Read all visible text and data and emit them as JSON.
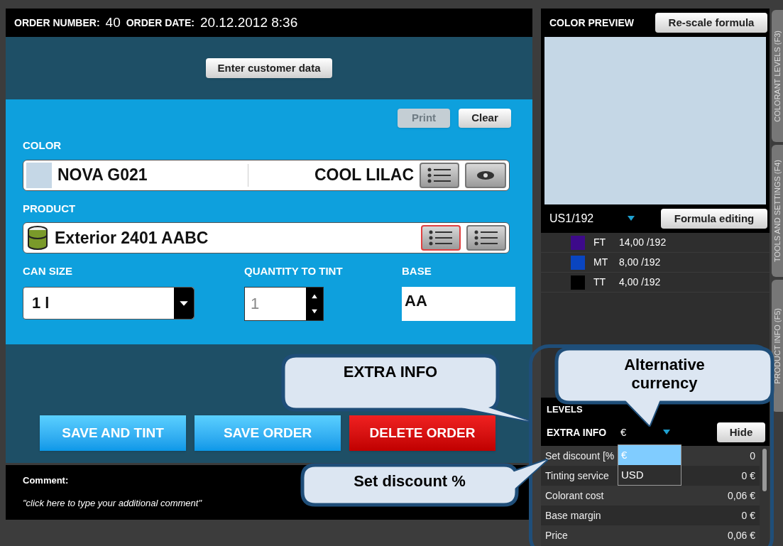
{
  "header": {
    "order_number_label": "ORDER NUMBER:",
    "order_number": "40",
    "order_date_label": "ORDER DATE:",
    "order_date": "20.12.2012 8:36"
  },
  "customer_button": "Enter customer data",
  "actions": [
    {
      "label": "Print",
      "disabled": true
    },
    {
      "label": "Clear",
      "disabled": false
    }
  ],
  "color": {
    "label": "COLOR",
    "code": "NOVA G021",
    "name": "COOL LILAC"
  },
  "product": {
    "label": "PRODUCT",
    "name": "Exterior 2401 AABC"
  },
  "can_size": {
    "label": "CAN SIZE",
    "value": "1 l"
  },
  "quantity": {
    "label": "QUANTITY TO TINT",
    "value": "1"
  },
  "base": {
    "label": "BASE",
    "value": "AA"
  },
  "buttons": [
    {
      "label": "SAVE AND TINT",
      "kind": "primary"
    },
    {
      "label": "SAVE ORDER",
      "kind": "primary"
    },
    {
      "label": "DELETE ORDER",
      "kind": "danger"
    }
  ],
  "comment": {
    "label": "Comment:",
    "placeholder": "\"click here to type your additional comment\""
  },
  "preview": {
    "title": "COLOR PREVIEW",
    "rescale_button": "Re-scale formula",
    "color": "#c5d7e6",
    "unit": "US1/192",
    "edit_button": "Formula editing"
  },
  "formula": [
    {
      "code": "FT",
      "amount": "14,00 /192",
      "color": "#3d0a8a"
    },
    {
      "code": "MT",
      "amount": "8,00 /192",
      "color": "#0a45c0"
    },
    {
      "code": "TT",
      "amount": "4,00 /192",
      "color": "#000000"
    }
  ],
  "levels_label": "LEVELS",
  "extra_info": {
    "title": "EXTRA INFO",
    "currency": "€",
    "hide_button": "Hide",
    "options": [
      {
        "label": "€",
        "selected": true
      },
      {
        "label": "USD",
        "selected": false
      }
    ],
    "rows": [
      {
        "label": "Set discount [%",
        "value": "0"
      },
      {
        "label": "Tinting service",
        "value": "0 €"
      },
      {
        "label": "Colorant cost",
        "value": "0,06 €"
      },
      {
        "label": "Base margin",
        "value": "0 €"
      },
      {
        "label": "Price",
        "value": "0,06 €"
      }
    ]
  },
  "side_tabs": [
    "COLORANT LEVELS (F3)",
    "TOOLS AND SETTINGS (F4)",
    "PRODUCT INFO (F5)"
  ],
  "callouts": [
    {
      "text": "EXTRA INFO",
      "kind": "extra"
    },
    {
      "text": "Alternative currency",
      "kind": "currency"
    },
    {
      "text": "Set discount %",
      "kind": "discount"
    }
  ]
}
